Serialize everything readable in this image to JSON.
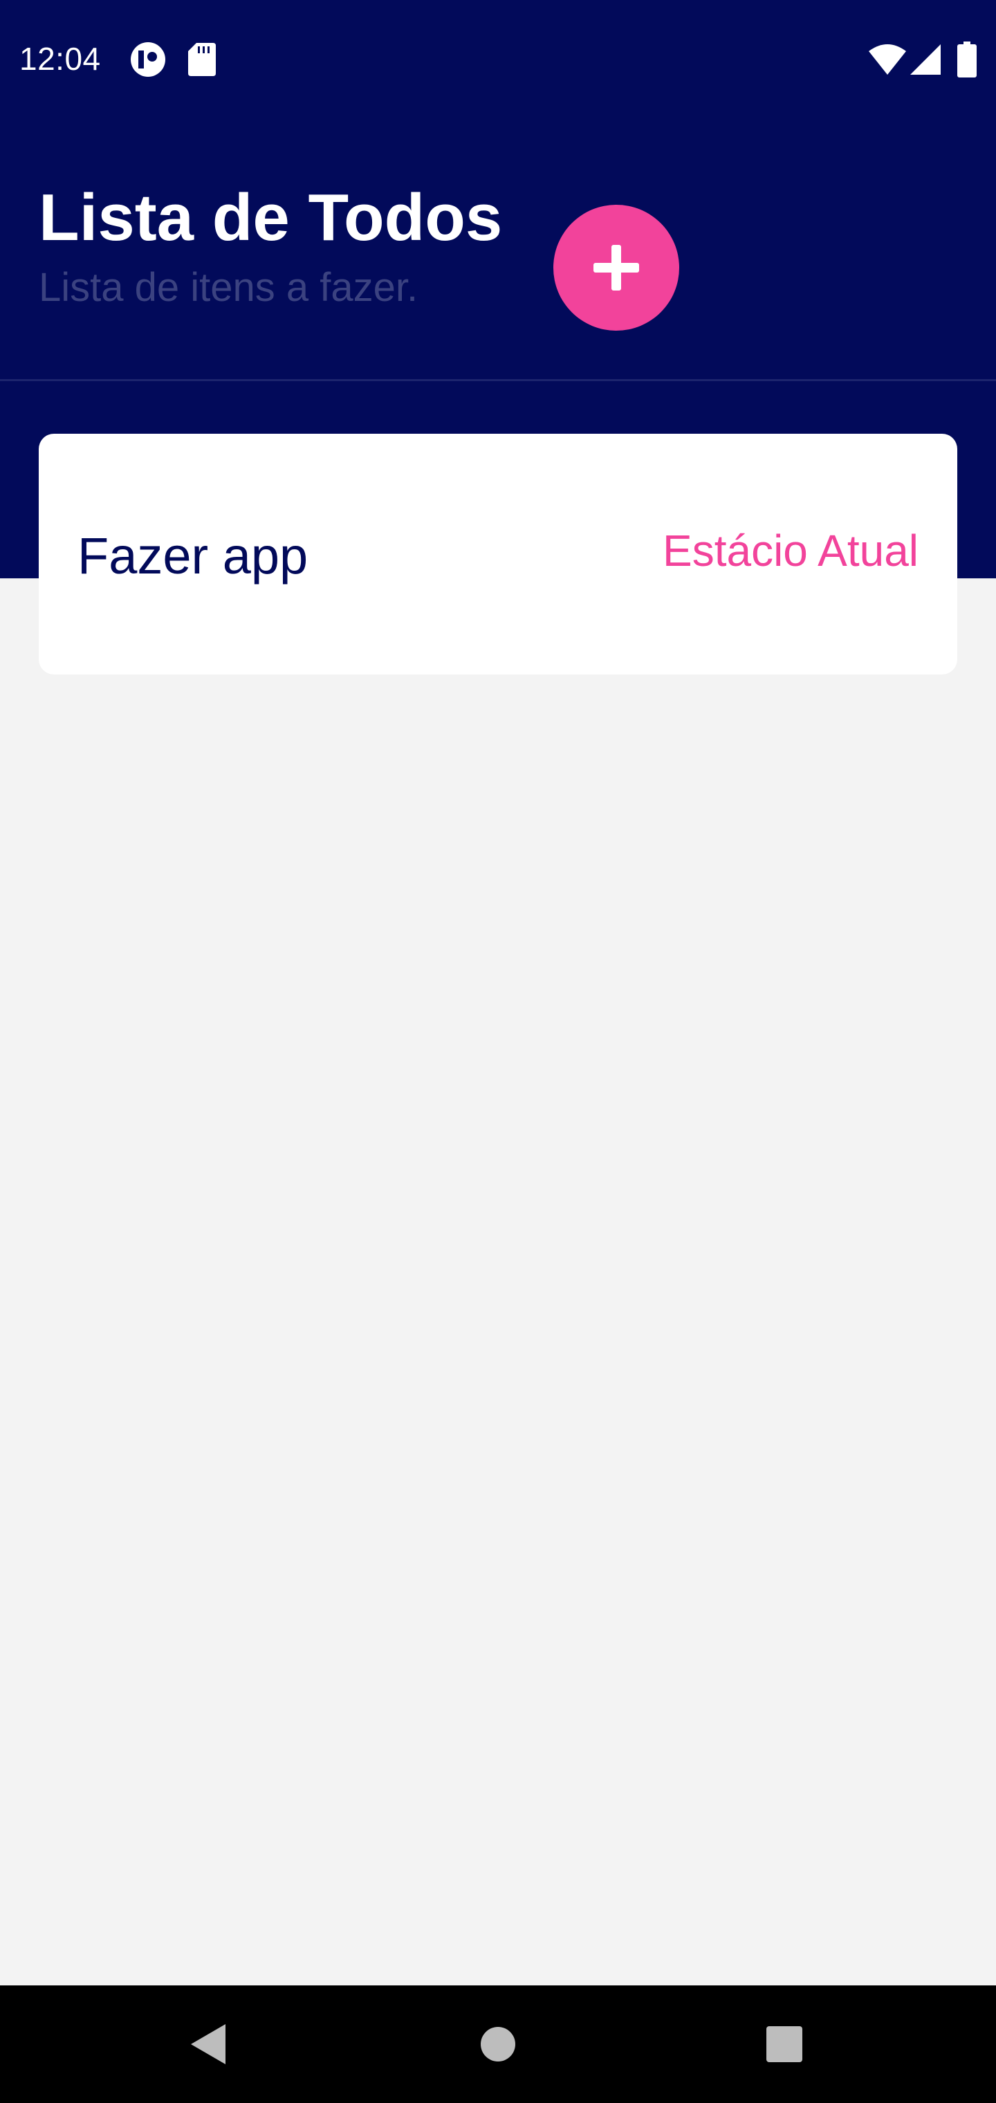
{
  "status_bar": {
    "time": "12:04",
    "icons": [
      "app-notification-icon",
      "sd-card-icon",
      "wifi-icon",
      "cell-signal-icon",
      "battery-icon"
    ]
  },
  "header": {
    "title": "Lista de Todos",
    "subtitle": "Lista de itens a fazer.",
    "add_button_icon": "plus-icon"
  },
  "todos": [
    {
      "title": "Fazer app",
      "tag": "Estácio Atual"
    }
  ],
  "nav_bar": {
    "icons": [
      "back-icon",
      "home-icon",
      "recents-icon"
    ]
  },
  "colors": {
    "primary": "#020a5a",
    "accent": "#f2439b",
    "background": "#f3f3f3",
    "card": "#ffffff",
    "subtitle": "#3b4280"
  }
}
